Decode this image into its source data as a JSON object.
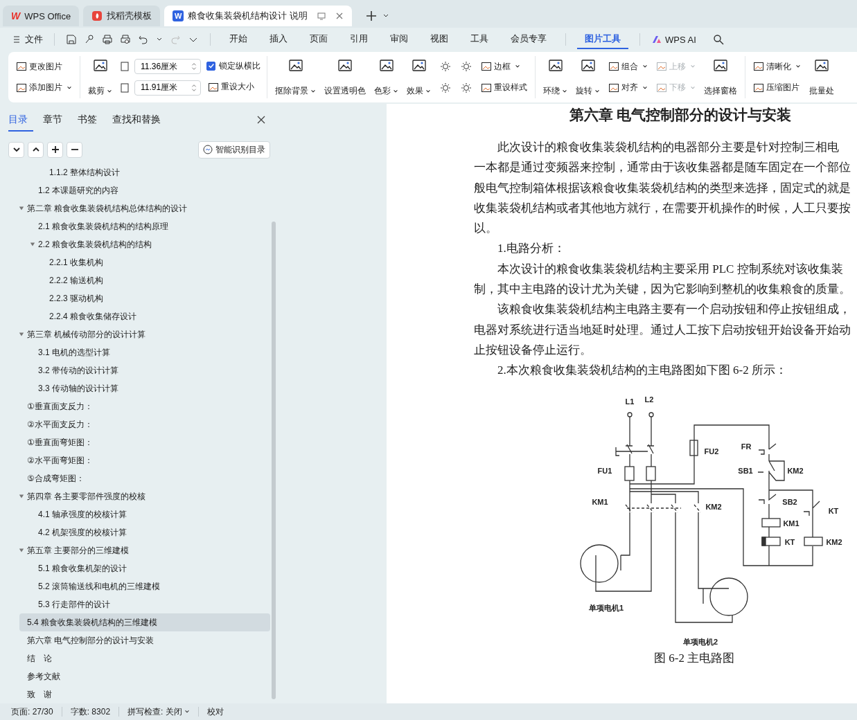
{
  "tabs": [
    {
      "kind": "wps",
      "icon_text": "W",
      "label": "WPS Office",
      "selected": false
    },
    {
      "kind": "docer",
      "label": "找稻壳模板",
      "selected": false
    },
    {
      "kind": "writer",
      "icon_text": "W",
      "label": "粮食收集装袋机结构设计 说明",
      "selected": true
    }
  ],
  "menu": {
    "file": "文件",
    "tabs": [
      {
        "label": "开始",
        "selected": false
      },
      {
        "label": "插入",
        "selected": false
      },
      {
        "label": "页面",
        "selected": false
      },
      {
        "label": "引用",
        "selected": false
      },
      {
        "label": "审阅",
        "selected": false
      },
      {
        "label": "视图",
        "selected": false
      },
      {
        "label": "工具",
        "selected": false
      },
      {
        "label": "会员专享",
        "selected": false
      },
      {
        "label": "图片工具",
        "selected": true
      }
    ],
    "ai": "WPS AI"
  },
  "ribbon": {
    "groups": [
      {
        "columns": [
          [
            {
              "kind": "small",
              "label": "更改图片",
              "dropdown": false,
              "disabled": false
            },
            {
              "kind": "small",
              "label": "添加图片",
              "dropdown": true,
              "disabled": false
            }
          ]
        ]
      },
      {
        "columns": [
          [
            {
              "kind": "large",
              "label": "裁剪",
              "dropdown": true,
              "disabled": false
            }
          ],
          [
            {
              "kind": "field",
              "value": "11.36厘米"
            },
            {
              "kind": "field",
              "value": "11.91厘米"
            }
          ],
          [
            {
              "kind": "check",
              "label": "锁定纵横比",
              "checked": true
            },
            {
              "kind": "small",
              "label": "重设大小",
              "dropdown": false,
              "disabled": false
            }
          ]
        ]
      },
      {
        "columns": [
          [
            {
              "kind": "large",
              "label": "抠除背景",
              "dropdown": true,
              "disabled": false
            }
          ],
          [
            {
              "kind": "large",
              "label": "设置透明色",
              "dropdown": false,
              "disabled": false
            }
          ],
          [
            {
              "kind": "large",
              "label": "色彩",
              "dropdown": true,
              "disabled": false
            }
          ],
          [
            {
              "kind": "large",
              "label": "效果",
              "dropdown": true,
              "disabled": false
            }
          ],
          [
            {
              "kind": "icon"
            },
            {
              "kind": "icon"
            }
          ],
          [
            {
              "kind": "icon"
            },
            {
              "kind": "icon"
            }
          ],
          [
            {
              "kind": "small",
              "label": "边框",
              "dropdown": true,
              "disabled": false
            },
            {
              "kind": "small",
              "label": "重设样式",
              "dropdown": false,
              "disabled": false
            }
          ]
        ]
      },
      {
        "columns": [
          [
            {
              "kind": "large",
              "label": "环绕",
              "dropdown": true,
              "disabled": false
            }
          ],
          [
            {
              "kind": "large",
              "label": "旋转",
              "dropdown": true,
              "disabled": false
            }
          ],
          [
            {
              "kind": "small",
              "label": "组合",
              "dropdown": true,
              "disabled": false
            },
            {
              "kind": "small",
              "label": "对齐",
              "dropdown": true,
              "disabled": false
            }
          ],
          [
            {
              "kind": "small",
              "label": "上移",
              "dropdown": true,
              "disabled": true
            },
            {
              "kind": "small",
              "label": "下移",
              "dropdown": true,
              "disabled": true
            }
          ],
          [
            {
              "kind": "large",
              "label": "选择窗格",
              "dropdown": false,
              "disabled": false
            }
          ]
        ]
      },
      {
        "columns": [
          [
            {
              "kind": "small",
              "label": "清晰化",
              "dropdown": true,
              "disabled": false
            },
            {
              "kind": "small",
              "label": "压缩图片",
              "dropdown": false,
              "disabled": false
            }
          ],
          [
            {
              "kind": "large",
              "label": "批量处",
              "dropdown": false,
              "disabled": false
            }
          ]
        ]
      }
    ]
  },
  "sidebar": {
    "tabs": [
      {
        "label": "目录",
        "selected": true
      },
      {
        "label": "章节",
        "selected": false
      },
      {
        "label": "书签",
        "selected": false
      },
      {
        "label": "查找和替换",
        "selected": false
      }
    ],
    "smart_button": "智能识别目录",
    "toc": [
      {
        "kind": "subsection",
        "label": "1.1.2 整体结构设计",
        "selected": false
      },
      {
        "kind": "section",
        "label": "1.2 本课题研究的内容",
        "selected": false
      },
      {
        "kind": "chapter",
        "label": "第二章 粮食收集装袋机结构总体结构的设计",
        "selected": false,
        "expanded": true,
        "children": [
          {
            "kind": "section",
            "label": "2.1 粮食收集装袋机结构的结构原理",
            "selected": false
          },
          {
            "kind": "section",
            "label": "2.2 粮食收集装袋机结构的结构",
            "selected": false,
            "expanded": true,
            "children": [
              {
                "kind": "subsection",
                "label": "2.2.1  收集机构",
                "selected": false
              },
              {
                "kind": "subsection",
                "label": "2.2.2  输送机构",
                "selected": false
              },
              {
                "kind": "subsection",
                "label": "2.2.3 驱动机构",
                "selected": false
              },
              {
                "kind": "subsection",
                "label": "2.2.4 粮食收集储存设计",
                "selected": false
              }
            ]
          }
        ]
      },
      {
        "kind": "chapter",
        "label": "第三章 机械传动部分的设计计算",
        "selected": false,
        "expanded": true,
        "children": [
          {
            "kind": "section",
            "label": "3.1 电机的选型计算",
            "selected": false
          },
          {
            "kind": "section",
            "label": "3.2 带传动的设计计算",
            "selected": false
          },
          {
            "kind": "section",
            "label": "3.3 传动轴的设计计算",
            "selected": false
          }
        ]
      },
      {
        "kind": "chapter",
        "label": "①垂直面支反力：",
        "selected": false
      },
      {
        "kind": "chapter",
        "label": "②水平面支反力：",
        "selected": false
      },
      {
        "kind": "chapter",
        "label": "①垂直面弯矩图：",
        "selected": false
      },
      {
        "kind": "chapter",
        "label": "②水平面弯矩图：",
        "selected": false
      },
      {
        "kind": "chapter",
        "label": "⑤合成弯矩图：",
        "selected": false
      },
      {
        "kind": "chapter",
        "label": "第四章 各主要零部件强度的校核",
        "selected": false,
        "expanded": true,
        "children": [
          {
            "kind": "section",
            "label": "4.1 轴承强度的校核计算",
            "selected": false
          },
          {
            "kind": "section",
            "label": "4.2 机架强度的校核计算",
            "selected": false
          }
        ]
      },
      {
        "kind": "chapter",
        "label": "第五章 主要部分的三维建模",
        "selected": false,
        "expanded": true,
        "children": [
          {
            "kind": "section",
            "label": "5.1 粮食收集机架的设计",
            "selected": false
          },
          {
            "kind": "section",
            "label": "5.2 滚筒输送线和电机的三维建模",
            "selected": false
          },
          {
            "kind": "section",
            "label": "5.3 行走部件的设计",
            "selected": false
          },
          {
            "kind": "section",
            "label": "5.4 粮食收集装袋机结构的三维建模",
            "selected": true
          }
        ]
      },
      {
        "kind": "chapter",
        "label": "第六章 电气控制部分的设计与安装",
        "selected": false
      },
      {
        "kind": "chapter",
        "label": "结　论",
        "selected": false
      },
      {
        "kind": "chapter",
        "label": "参考文献",
        "selected": false
      },
      {
        "kind": "chapter",
        "label": "致　谢",
        "selected": false
      }
    ]
  },
  "document": {
    "heading": "第六章  电气控制部分的设计与安装",
    "lines": [
      {
        "text": "此次设计的粮食收集装袋机结构的电器部分主要是针对控制三相电",
        "indent": true
      },
      {
        "text": "一本都是通过变频器来控制，通常由于该收集器都是随车固定在一个部位",
        "indent": false
      },
      {
        "text": "般电气控制箱体根据该粮食收集装袋机结构的类型来选择，固定式的就是",
        "indent": false
      },
      {
        "text": "收集装袋机结构或者其他地方就行，在需要开机操作的时候，人工只要按",
        "indent": false
      },
      {
        "text": "以。",
        "indent": false
      },
      {
        "text": "1.电路分析：",
        "indent": true
      },
      {
        "text": "本次设计的粮食收集装袋机结构主要采用 PLC 控制系统对该收集装",
        "indent": true
      },
      {
        "text": "制，其中主电路的设计尤为关键，因为它影响到整机的收集粮食的质量。",
        "indent": false
      },
      {
        "text": "该粮食收集装袋机结构主电路主要有一个启动按钮和停止按钮组成，",
        "indent": true
      },
      {
        "text": "电器对系统进行适当地延时处理。通过人工按下启动按钮开始设备开始动",
        "indent": false
      },
      {
        "text": "止按钮设备停止运行。",
        "indent": false
      },
      {
        "text": "2.本次粮食收集装袋机结构的主电路图如下图 6-2 所示：",
        "indent": true
      }
    ],
    "figure": {
      "labels": [
        "L1",
        "L2",
        "FU2",
        "FR",
        "FU1",
        "SB1",
        "KM2",
        "KM1",
        "KM2",
        "SB2",
        "KT",
        "KM1",
        "KT",
        "KM2",
        "单项电机1",
        "单项电机2"
      ],
      "caption": "图 6-2  主电路图"
    }
  },
  "status_bar": {
    "page": "页面: 27/30",
    "words": "字数: 8302",
    "spell": "拼写检查: 关闭",
    "proof": "校对"
  }
}
